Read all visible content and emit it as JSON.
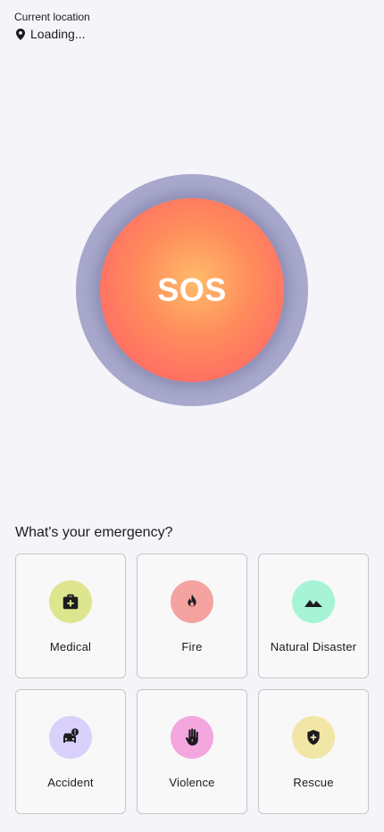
{
  "location": {
    "label": "Current location",
    "value": "Loading...",
    "icon": "map-pin-icon"
  },
  "sos": {
    "label": "SOS",
    "outer_color": "#a8a8cd",
    "gradient": [
      "#ffbb6a",
      "#ff6666"
    ]
  },
  "emergency": {
    "question": "What's your emergency?",
    "categories": [
      {
        "label": "Medical",
        "icon": "medical-kit-icon",
        "color": "#dde58f"
      },
      {
        "label": "Fire",
        "icon": "fire-icon",
        "color": "#f4a3a0"
      },
      {
        "label": "Natural Disaster",
        "icon": "mountain-icon",
        "color": "#a6f3d5"
      },
      {
        "label": "Accident",
        "icon": "car-crash-icon",
        "color": "#d9d1fb"
      },
      {
        "label": "Violence",
        "icon": "hand-stop-icon",
        "color": "#f4a6df"
      },
      {
        "label": "Rescue",
        "icon": "shield-plus-icon",
        "color": "#f2e6a7"
      }
    ]
  }
}
